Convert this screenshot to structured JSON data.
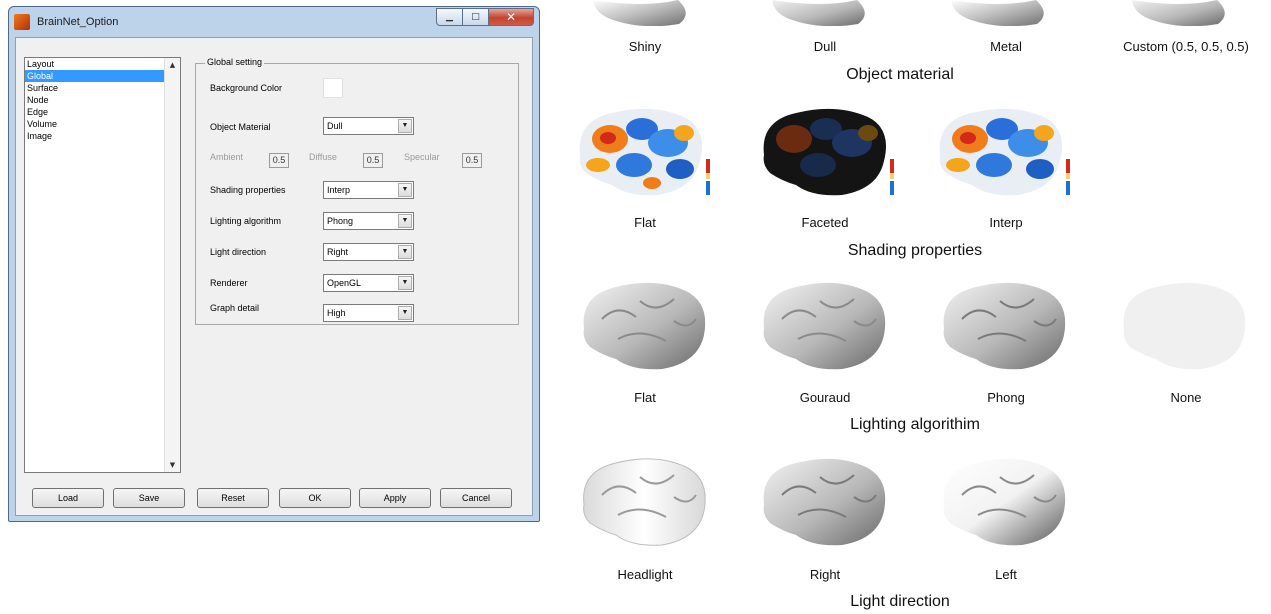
{
  "window": {
    "title": "BrainNet_Option",
    "controls": {
      "minimize": "▁",
      "maximize": "□",
      "close": "✕"
    }
  },
  "list": {
    "items": [
      "Layout",
      "Global",
      "Surface",
      "Node",
      "Edge",
      "Volume",
      "Image"
    ],
    "selected": "Global"
  },
  "global_setting": {
    "group_label": "Global setting",
    "background_color_label": "Background Color",
    "background_color_value": "#ffffff",
    "object_material_label": "Object Material",
    "object_material_value": "Dull",
    "ambient_label": "Ambient",
    "ambient_value": "0.5",
    "diffuse_label": "Diffuse",
    "diffuse_value": "0.5",
    "specular_label": "Specular",
    "specular_value": "0.5",
    "shading_label": "Shading properties",
    "shading_value": "Interp",
    "lighting_label": "Lighting algorithm",
    "lighting_value": "Phong",
    "light_direction_label": "Light direction",
    "light_direction_value": "Right",
    "renderer_label": "Renderer",
    "renderer_value": "OpenGL",
    "graph_detail_label": "Graph detail",
    "graph_detail_value": "High"
  },
  "buttons": {
    "load": "Load",
    "save": "Save",
    "reset": "Reset",
    "ok": "OK",
    "apply": "Apply",
    "cancel": "Cancel"
  },
  "figure": {
    "object_material": {
      "title": "Object material",
      "items": [
        "Shiny",
        "Dull",
        "Metal",
        "Custom (0.5, 0.5, 0.5)"
      ]
    },
    "shading_properties": {
      "title": "Shading properties",
      "items": [
        "Flat",
        "Faceted",
        "Interp"
      ]
    },
    "lighting_algorithm": {
      "title": "Lighting algorithim",
      "items": [
        "Flat",
        "Gouraud",
        "Phong",
        "None"
      ]
    },
    "light_direction": {
      "title": "Light direction",
      "items": [
        "Headlight",
        "Right",
        "Left"
      ]
    }
  },
  "colors": {
    "selection": "#3399ff",
    "window_frame": "#bcd3ea",
    "client": "#f0f0f0"
  }
}
